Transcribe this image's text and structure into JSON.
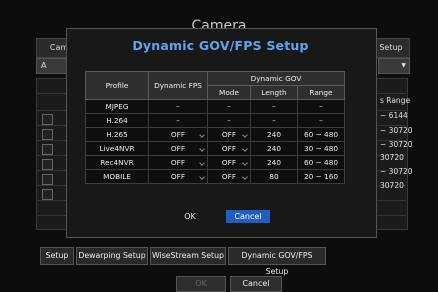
{
  "background": {
    "title": "Camera",
    "tab_left": "Cam",
    "tab_right": "Setup",
    "select_left": "A",
    "range_header": "s Range",
    "ranges": [
      "~ 6144",
      "~ 30720",
      "~ 30720",
      "30720",
      "~ 30720",
      "30720"
    ],
    "tabs": [
      "Setup",
      "Dewarping Setup",
      "WiseStream Setup",
      "Dynamic GOV/FPS Setup"
    ],
    "ok_label": "OK",
    "cancel_label": "Cancel"
  },
  "dialog": {
    "title": "Dynamic GOV/FPS Setup",
    "headers": {
      "profile": "Profile",
      "dynamic_fps": "Dynamic FPS",
      "dynamic_gov": "Dynamic GOV",
      "mode": "Mode",
      "length": "Length",
      "range": "Range"
    },
    "rows": [
      {
        "profile": "MJPEG",
        "fps": "–",
        "mode": "–",
        "length": "–",
        "range": "–"
      },
      {
        "profile": "H.264",
        "fps": "–",
        "mode": "–",
        "length": "–",
        "range": "–"
      },
      {
        "profile": "H.265",
        "fps": "OFF",
        "mode": "OFF",
        "length": "240",
        "range": "60 ~ 480"
      },
      {
        "profile": "Live4NVR",
        "fps": "OFF",
        "mode": "OFF",
        "length": "240",
        "range": "30 ~ 480"
      },
      {
        "profile": "Rec4NVR",
        "fps": "OFF",
        "mode": "OFF",
        "length": "240",
        "range": "60 ~ 480"
      },
      {
        "profile": "MOBILE",
        "fps": "OFF",
        "mode": "OFF",
        "length": "80",
        "range": "20 ~ 160"
      }
    ],
    "ok_label": "OK",
    "cancel_label": "Cancel",
    "accent": "#5fa4ee",
    "cancel_color": "#1f5fc4"
  }
}
